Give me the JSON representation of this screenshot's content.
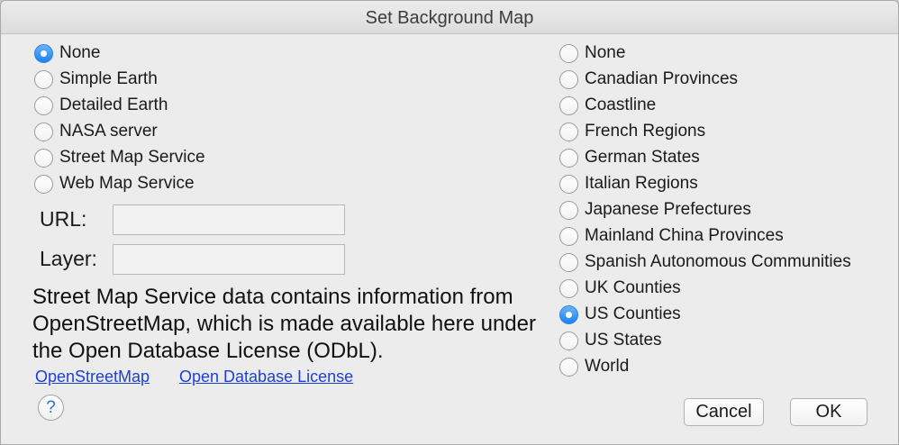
{
  "window": {
    "title": "Set Background Map"
  },
  "basemap_options": [
    {
      "label": "None",
      "selected": true
    },
    {
      "label": "Simple Earth",
      "selected": false
    },
    {
      "label": "Detailed Earth",
      "selected": false
    },
    {
      "label": "NASA server",
      "selected": false
    },
    {
      "label": "Street Map Service",
      "selected": false
    },
    {
      "label": "Web Map Service",
      "selected": false
    }
  ],
  "wms": {
    "url_label": "URL:",
    "url_value": "",
    "layer_label": "Layer:",
    "layer_value": ""
  },
  "info": {
    "text": "Street Map Service data contains information from OpenStreetMap, which is made available here under the Open Database License (ODbL).",
    "link_osm": "OpenStreetMap",
    "link_odbl": "Open Database License"
  },
  "overlay_options": [
    {
      "label": "None",
      "selected": false
    },
    {
      "label": "Canadian Provinces",
      "selected": false
    },
    {
      "label": "Coastline",
      "selected": false
    },
    {
      "label": "French Regions",
      "selected": false
    },
    {
      "label": "German States",
      "selected": false
    },
    {
      "label": "Italian Regions",
      "selected": false
    },
    {
      "label": "Japanese Prefectures",
      "selected": false
    },
    {
      "label": "Mainland China Provinces",
      "selected": false
    },
    {
      "label": "Spanish Autonomous Communities",
      "selected": false
    },
    {
      "label": "UK Counties",
      "selected": false
    },
    {
      "label": "US Counties",
      "selected": true
    },
    {
      "label": "US States",
      "selected": false
    },
    {
      "label": "World",
      "selected": false
    }
  ],
  "buttons": {
    "help": "?",
    "cancel": "Cancel",
    "ok": "OK"
  },
  "colors": {
    "accent": "#1a82fb",
    "link": "#1d3fd6"
  }
}
